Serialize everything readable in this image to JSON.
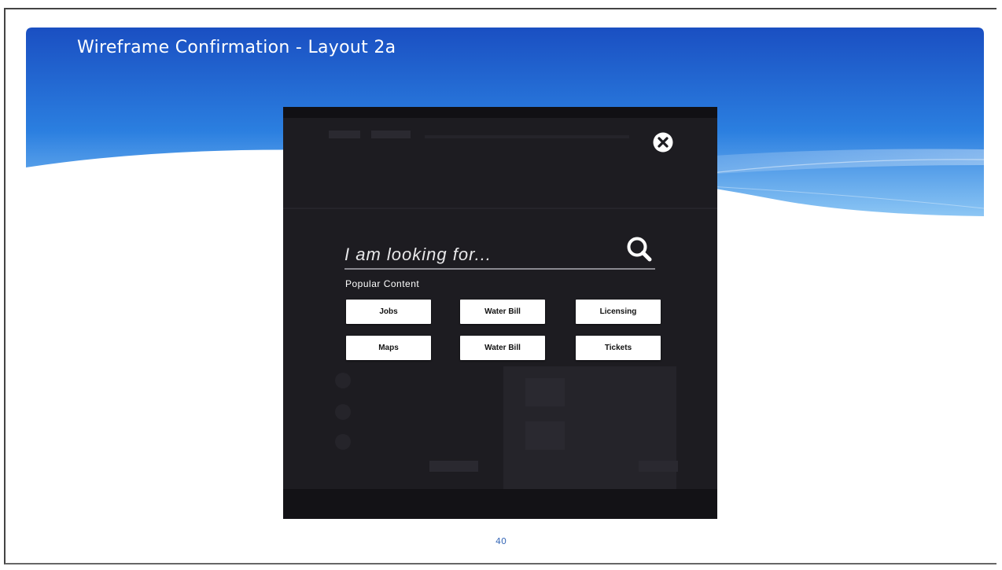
{
  "slide": {
    "title": "Wireframe Confirmation - Layout 2a",
    "page_number": "40"
  },
  "modal": {
    "search": {
      "placeholder": "I am looking for..."
    },
    "popular_label": "Popular Content",
    "buttons": [
      "Jobs",
      "Water Bill",
      "Licensing",
      "Maps",
      "Water Bill",
      "Tickets"
    ]
  },
  "colors": {
    "header_blue_dark": "#1a55c4",
    "header_blue_light": "#7ec0f4",
    "modal_bg": "#1d1c21",
    "page_number": "#3a6ab8"
  },
  "icons": {
    "close": "close-circle-icon",
    "search": "search-icon"
  }
}
